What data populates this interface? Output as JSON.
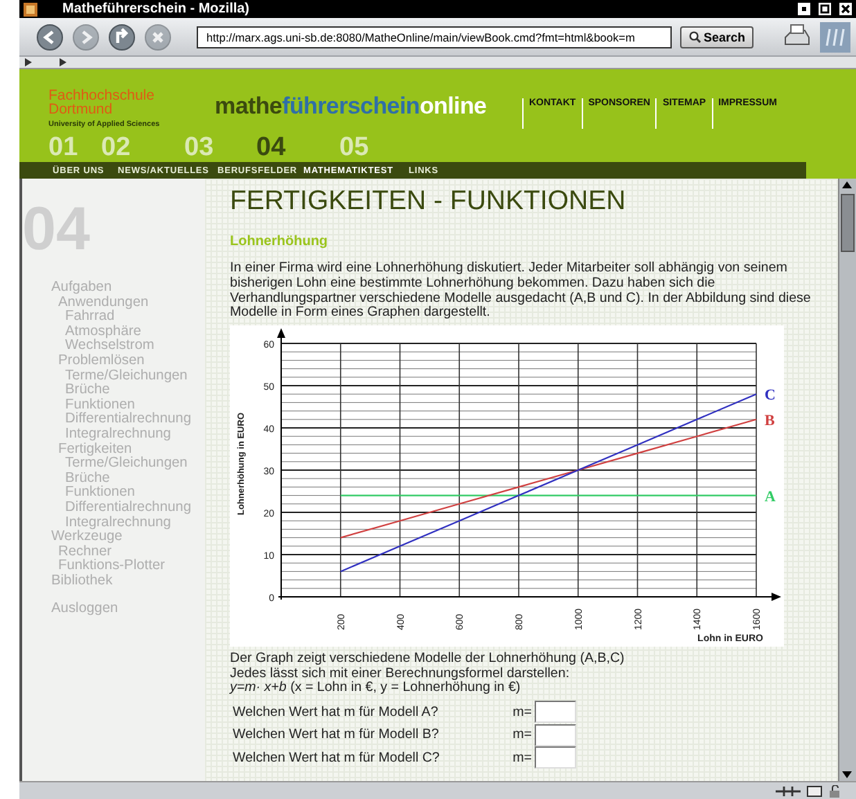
{
  "window": {
    "title": "Matheführerschein - Mozilla)"
  },
  "toolbar": {
    "nav_buttons": [
      {
        "kind": "back",
        "disabled": false
      },
      {
        "kind": "forward",
        "disabled": true
      },
      {
        "kind": "reload",
        "disabled": false
      },
      {
        "kind": "stop",
        "disabled": true
      }
    ],
    "url": "http://marx.ags.uni-sb.de:8080/MatheOnline/main/viewBook.cmd?fmt=html&book=m",
    "search_button": "Search"
  },
  "header": {
    "school": [
      "Fachhochschule",
      "Dortmund"
    ],
    "school_sub": "University of Applied Sciences",
    "brand": [
      "mathe",
      "führerschein",
      "online"
    ],
    "links": [
      "KONTAKT",
      "SPONSOREN",
      "SITEMAP",
      "IMPRESSUM"
    ],
    "nav": [
      {
        "number": "01",
        "label": "ÜBER UNS",
        "selected": false
      },
      {
        "number": "02",
        "label": "NEWS/AKTUELLES",
        "selected": false
      },
      {
        "number": "03",
        "label": "BERUFSFELDER",
        "selected": false
      },
      {
        "number": "04",
        "label": "MATHEMATIKTEST",
        "selected": true
      },
      {
        "number": "05",
        "label": "LINKS",
        "selected": false
      }
    ]
  },
  "sidebar": {
    "section_number": "04",
    "items": [
      {
        "label": "Aufgaben",
        "children": [
          {
            "label": "Anwendungen",
            "children": [
              {
                "label": "Fahrrad"
              },
              {
                "label": "Atmosphäre"
              },
              {
                "label": "Wechselstrom"
              }
            ]
          },
          {
            "label": "Problemlösen",
            "children": [
              {
                "label": "Terme/Gleichungen"
              },
              {
                "label": "Brüche"
              },
              {
                "label": "Funktionen"
              },
              {
                "label": "Differentialrechnung"
              },
              {
                "label": "Integralrechnung"
              }
            ]
          },
          {
            "label": "Fertigkeiten",
            "children": [
              {
                "label": "Terme/Gleichungen"
              },
              {
                "label": "Brüche"
              },
              {
                "label": "Funktionen"
              },
              {
                "label": "Differentialrechnung"
              },
              {
                "label": "Integralrechnung"
              }
            ]
          }
        ]
      },
      {
        "label": "Werkzeuge",
        "children": [
          {
            "label": "Rechner"
          },
          {
            "label": "Funktions-Plotter"
          }
        ]
      },
      {
        "label": "Bibliothek"
      }
    ],
    "logout": "Ausloggen"
  },
  "content": {
    "title": "FERTIGKEITEN - FUNKTIONEN",
    "subtitle": "Lohnerhöhung",
    "intro": "In einer Firma wird eine Lohnerhöhung diskutiert. Jeder Mitarbeiter soll abhängig von seinem bisherigen Lohn eine bestimmte Lohnerhöhung bekommen. Dazu haben sich die Verhandlungspartner verschiedene Modelle ausgedacht (A,B und C). In der Abbildung sind diese Modelle in Form eines Graphen dargestellt.",
    "chart_data": {
      "type": "line",
      "xlabel": "Lohn in EURO",
      "ylabel": "Lohnerhöhung in EURO",
      "x": [
        200,
        400,
        600,
        800,
        1000,
        1200,
        1400,
        1600
      ],
      "series": [
        {
          "name": "A",
          "color": "#33cc66",
          "values": [
            24,
            24,
            24,
            24,
            24,
            24,
            24,
            24
          ]
        },
        {
          "name": "B",
          "color": "#d04040",
          "values": [
            14,
            18,
            22,
            26,
            30,
            34,
            38,
            42
          ]
        },
        {
          "name": "C",
          "color": "#3030c0",
          "values": [
            6,
            12,
            18,
            24,
            30,
            36,
            42,
            48
          ]
        }
      ],
      "grid": true,
      "xlim": [
        0,
        1600
      ],
      "ylim": [
        0,
        60
      ],
      "xticks": [
        200,
        400,
        600,
        800,
        1000,
        1200,
        1400,
        1600
      ],
      "yticks": [
        0,
        10,
        20,
        30,
        40,
        50,
        60
      ]
    },
    "explanation": [
      "Der Graph zeigt verschiedene Modelle der Lohnerhöhung (A,B,C)",
      "Jedes lässt sich mit einer Berechnungsformel darstellen:",
      "*y=m· x+b* (x = Lohn in €, y = Lohnerhöhung in €)"
    ],
    "questions": [
      {
        "label": "Welchen Wert hat m für Modell A?",
        "prefix": "m="
      },
      {
        "label": "Welchen Wert hat m für Modell B?",
        "prefix": "m="
      },
      {
        "label": "Welchen Wert hat m für Modell C?",
        "prefix": "m="
      }
    ]
  }
}
